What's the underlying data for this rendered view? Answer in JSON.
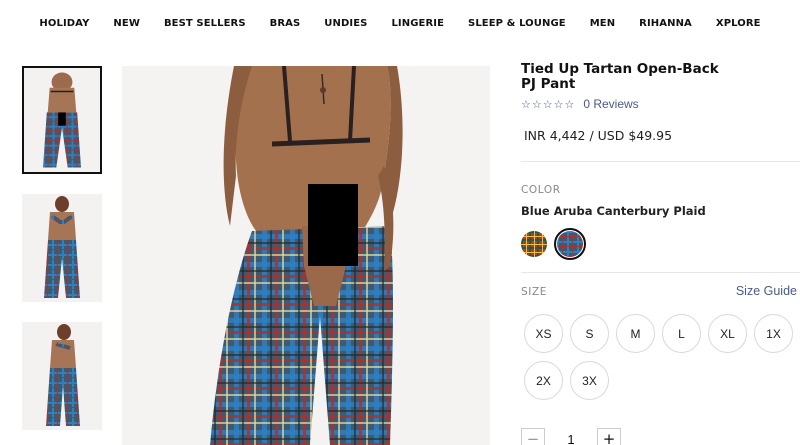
{
  "nav": {
    "items": [
      "HOLIDAY",
      "NEW",
      "BEST SELLERS",
      "BRAS",
      "UNDIES",
      "LINGERIE",
      "SLEEP & LOUNGE",
      "MEN",
      "RIHANNA",
      "XPLORE"
    ]
  },
  "product": {
    "title": "Tied Up Tartan Open-Back PJ Pant",
    "stars": "☆☆☆☆☆",
    "reviews_label": "0 Reviews",
    "price": "INR 4,442 / USD  $49.95",
    "color_heading": "COLOR",
    "color_name": "Blue Aruba Canterbury Plaid",
    "swatches": [
      {
        "name": "red-tartan",
        "selected": false
      },
      {
        "name": "blue-tartan",
        "selected": true
      }
    ],
    "size_heading": "SIZE",
    "size_guide_label": "Size Guide",
    "sizes": [
      "XS",
      "S",
      "M",
      "L",
      "XL",
      "1X",
      "2X",
      "3X"
    ],
    "quantity": {
      "minus": "−",
      "value": "1",
      "plus": "+"
    }
  },
  "colors": {
    "accent_link": "#4a5a8a",
    "plaid_base": "#3d5a6e",
    "plaid_red": "#a83232",
    "plaid_blue": "#2f7fc1"
  }
}
